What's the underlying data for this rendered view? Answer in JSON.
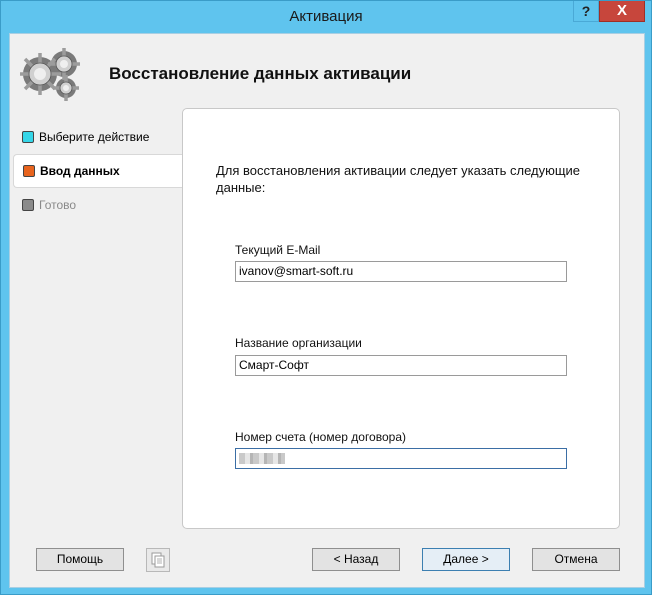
{
  "window": {
    "title": "Активация"
  },
  "titlebar_buttons": {
    "help": "?",
    "close": "X"
  },
  "header": {
    "title": "Восстановление данных активации",
    "logo_icon": "gears-icon"
  },
  "steps": [
    {
      "label": "Выберите действие",
      "color": "#35d6e8",
      "state": "done"
    },
    {
      "label": "Ввод данных",
      "color": "#e8641e",
      "state": "active"
    },
    {
      "label": "Готово",
      "color": "#8a8a8a",
      "state": "pending"
    }
  ],
  "form": {
    "instruction": "Для восстановления активации следует указать следующие данные:",
    "email": {
      "label": "Текущий E-Mail",
      "value": "ivanov@smart-soft.ru"
    },
    "org": {
      "label": "Название организации",
      "value": "Смарт-Софт"
    },
    "account": {
      "label": "Номер счета (номер договора)",
      "value": ""
    }
  },
  "buttons": {
    "help": "Помощь",
    "back": "< Назад",
    "next": "Далее >",
    "cancel": "Отмена"
  }
}
